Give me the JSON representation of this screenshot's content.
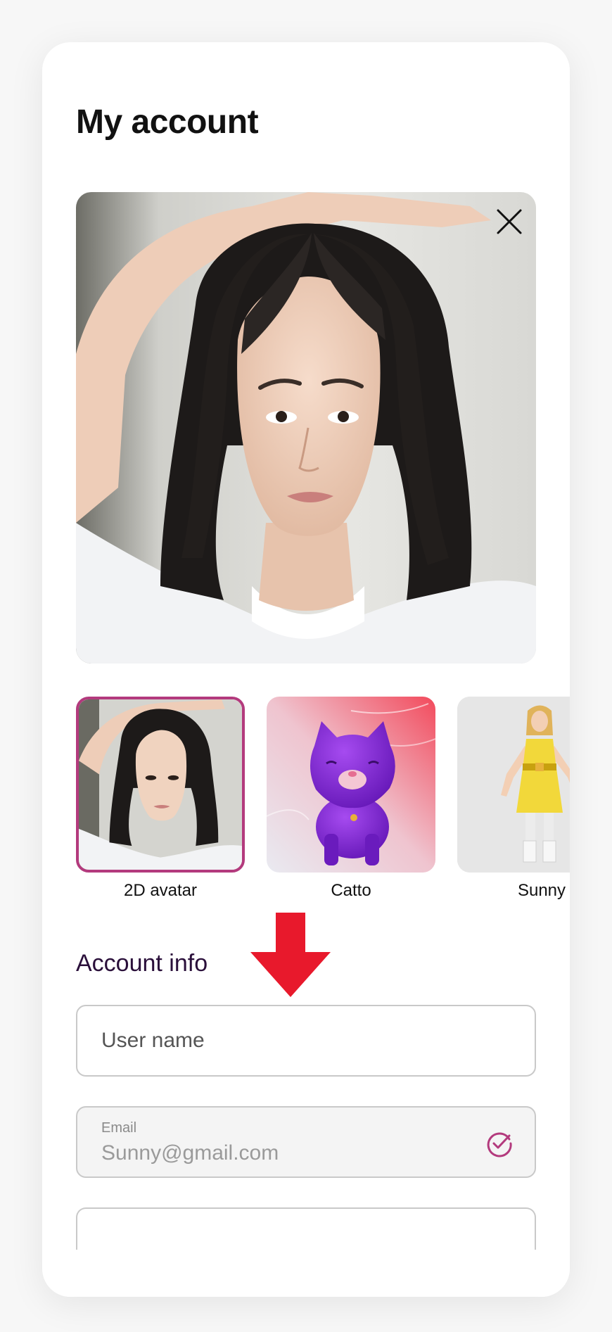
{
  "page": {
    "title": "My account"
  },
  "hero": {
    "close_icon": "close-icon"
  },
  "avatars": [
    {
      "label": "2D avatar",
      "selected": true
    },
    {
      "label": "Catto",
      "selected": false
    },
    {
      "label": "Sunny",
      "selected": false
    }
  ],
  "account_info": {
    "title": "Account info",
    "username": {
      "placeholder": "User name",
      "value": ""
    },
    "email": {
      "label": "Email",
      "value": "Sunny@gmail.com",
      "verified_icon": "check-circle-icon"
    }
  },
  "colors": {
    "accent": "#b33a7d",
    "arrow": "#e8192c",
    "section_title": "#2a0f3a"
  }
}
